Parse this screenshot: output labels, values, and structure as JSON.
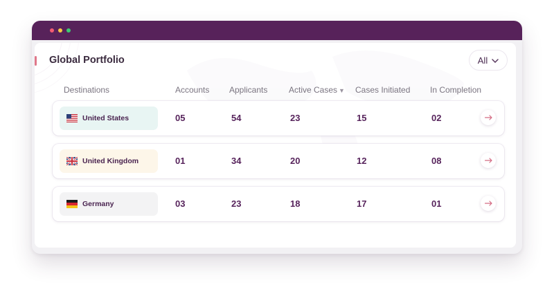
{
  "window": {
    "colors": {
      "titlebar": "#57225a",
      "accent": "#e0778a",
      "value_text": "#57245c"
    }
  },
  "portfolio": {
    "title": "Global Portfolio",
    "filter": {
      "selected": "All",
      "icon": "chevron-down-icon"
    },
    "columns": {
      "destinations": "Destinations",
      "accounts": "Accounts",
      "applicants": "Applicants",
      "active_cases": "Active Cases",
      "cases_initiated": "Cases Initiated",
      "in_completion": "In Completion"
    },
    "rows": [
      {
        "country": "United States",
        "flag": "us-flag-icon",
        "badge_color": "#e8f5f3",
        "accounts": "05",
        "applicants": "54",
        "active_cases": "23",
        "cases_initiated": "15",
        "in_completion": "02"
      },
      {
        "country": "United Kingdom",
        "flag": "uk-flag-icon",
        "badge_color": "#fdf6e9",
        "accounts": "01",
        "applicants": "34",
        "active_cases": "20",
        "cases_initiated": "12",
        "in_completion": "08"
      },
      {
        "country": "Germany",
        "flag": "germany-flag-icon",
        "badge_color": "#f3f3f4",
        "accounts": "03",
        "applicants": "23",
        "active_cases": "18",
        "cases_initiated": "17",
        "in_completion": "01"
      }
    ]
  }
}
